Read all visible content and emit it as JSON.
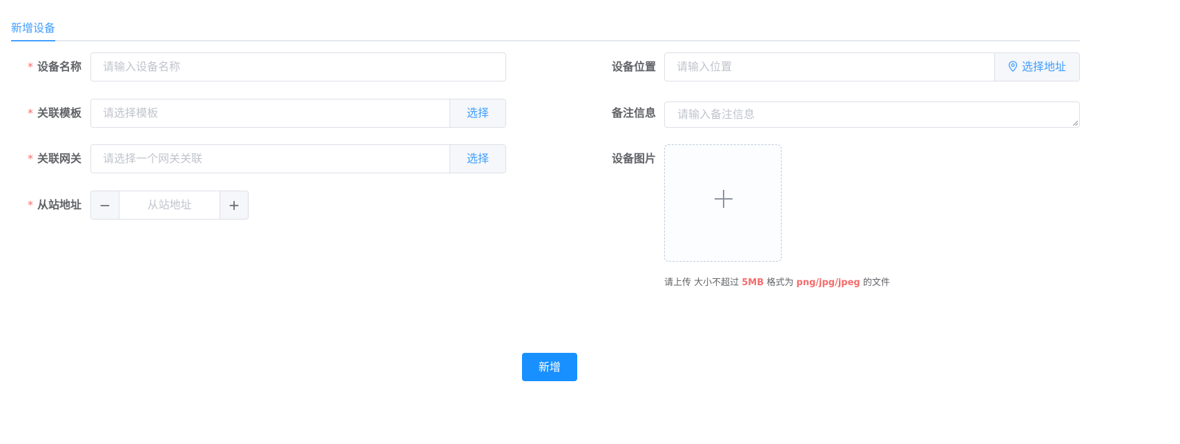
{
  "tabs": {
    "active_label": "新增设备"
  },
  "form": {
    "required_mark": "*",
    "device_name": {
      "label": "设备名称",
      "placeholder": "请输入设备名称"
    },
    "template": {
      "label": "关联模板",
      "placeholder": "请选择模板",
      "button": "选择"
    },
    "gateway": {
      "label": "关联网关",
      "placeholder": "请选择一个网关关联",
      "button": "选择"
    },
    "slave_address": {
      "label": "从站地址",
      "placeholder": "从站地址",
      "minus": "−",
      "plus": "+"
    },
    "location": {
      "label": "设备位置",
      "placeholder": "请输入位置",
      "button": "选择地址",
      "icon": "location-pin-icon"
    },
    "remark": {
      "label": "备注信息",
      "placeholder": "请输入备注信息"
    },
    "image": {
      "label": "设备图片",
      "icon": "plus-icon",
      "tip_prefix": "请上传 大小不超过 ",
      "tip_size": "5MB",
      "tip_middle": " 格式为 ",
      "tip_formats": "png/jpg/jpeg",
      "tip_suffix": " 的文件"
    }
  },
  "submit_label": "新增",
  "colors": {
    "primary": "#409eff",
    "button": "#1890ff",
    "danger": "#f56c6c",
    "border": "#dcdfe6"
  }
}
